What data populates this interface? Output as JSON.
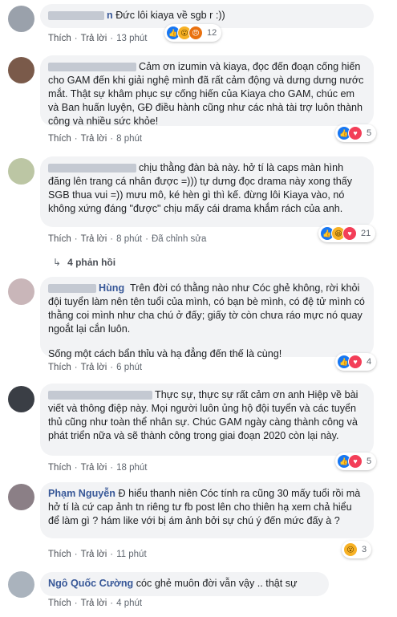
{
  "actions": {
    "like": "Thích",
    "reply": "Trả lời",
    "edited": "Đã chỉnh sửa",
    "sep": "·"
  },
  "comments": [
    {
      "name": "n",
      "text": "Đức lôi kiaya về sgb r :))",
      "time": "13 phút",
      "reactions": [
        "like",
        "wow",
        "angry"
      ],
      "count": "12"
    },
    {
      "paras": [
        "Cảm ơn izumin và kiaya, đọc đến đoạn cống hiến cho GAM đến khi giải nghệ mình đã rất cảm động và dưng dưng nước mắt. Thật sự khâm phục sự cống hiến của Kiaya cho GAM, chúc em và Ban huấn luyện, GĐ điều hành cũng như các nhà tài trợ luôn thành công và nhiều sức khỏe!"
      ],
      "time": "8 phút",
      "reactions": [
        "like",
        "love"
      ],
      "count": "5"
    },
    {
      "paras": [
        "chịu thằng đàn bà này. hở tí là caps màn hình đăng lên trang cá nhân được =))) tự dưng đọc drama này xong thấy SGB thua vui =)) mưu mô, ké hèn gì thì kế. đừng lôi Kiaya vào, nó không xứng đáng \"được\" chịu mấy cái drama khắm rách của anh."
      ],
      "time": "8 phút",
      "reactions": [
        "like",
        "wow",
        "love"
      ],
      "count": "21",
      "replies": "4 phản hồi"
    },
    {
      "name": "Hùng",
      "paras": [
        "Trên đời có thằng nào như Cóc ghẻ không, rời khỏi đội tuyển làm nên tên tuổi của mình, có bạn bè mình, có đệ tử mình có thằng coi mình như cha chú ở đấy; giấy tờ còn chưa ráo mực nó quay ngoắt lại cắn luôn.",
        "Sống một cách bẩn thỉu và hạ đẳng đến thế là cùng!"
      ],
      "time": "6 phút",
      "reactions": [
        "like",
        "love"
      ],
      "count": "4"
    },
    {
      "paras": [
        "Thực sự, thực sự rất cảm ơn anh Hiệp về bài viết và thông điệp này. Mọi người luôn ủng hộ đội tuyển và các tuyển thủ cũng như toàn thể nhân sự. Chúc GAM ngày càng thành công và phát triển nữa và sẽ thành công trong giai đoạn 2020 còn lại này."
      ],
      "time": "18 phút",
      "reactions": [
        "like",
        "love"
      ],
      "count": "5"
    },
    {
      "name": "Phạm Nguyễn",
      "paras": [
        "Đ hiểu thanh niên Cóc tính ra cũng 30 mấy tuổi rồi mà hở tí là cứ cap ảnh tn riêng tư fb post lên cho thiên hạ xem chả hiểu để làm gì ? hám like với bị ám ảnh bởi sự chú ý đến mức đấy à ?"
      ],
      "time": "11 phút",
      "reactions": [
        "wow"
      ],
      "count": "3"
    },
    {
      "name": "Ngô Quốc Cường",
      "paras": [
        "cóc ghẻ muôn đời vẫn vậy .. thật sự"
      ],
      "time": "4 phút"
    }
  ]
}
